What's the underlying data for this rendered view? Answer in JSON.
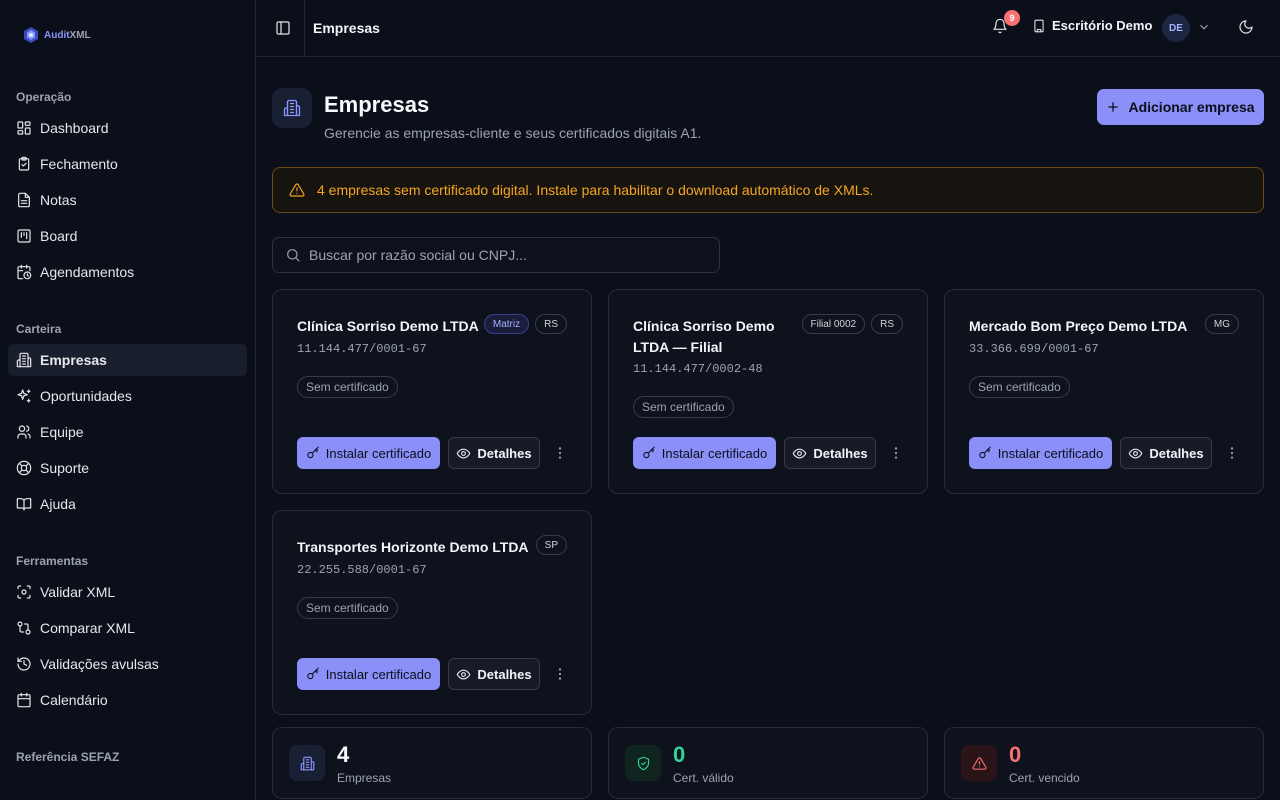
{
  "app": {
    "logo_prefix": "Audit",
    "logo_suffix": "XML"
  },
  "sidebar": {
    "sections": [
      {
        "label": "Operação"
      },
      {
        "label": "Carteira"
      },
      {
        "label": "Ferramentas"
      },
      {
        "label": "Referência SEFAZ"
      }
    ],
    "items": [
      {
        "label": "Dashboard",
        "icon": "layout-grid-icon"
      },
      {
        "label": "Fechamento",
        "icon": "clipboard-check-icon"
      },
      {
        "label": "Notas",
        "icon": "file-text-icon"
      },
      {
        "label": "Board",
        "icon": "kanban-icon"
      },
      {
        "label": "Agendamentos",
        "icon": "calendar-clock-icon"
      },
      {
        "label": "Empresas",
        "icon": "building-icon",
        "active": true
      },
      {
        "label": "Oportunidades",
        "icon": "sparkles-icon"
      },
      {
        "label": "Equipe",
        "icon": "users-icon"
      },
      {
        "label": "Suporte",
        "icon": "life-buoy-icon"
      },
      {
        "label": "Ajuda",
        "icon": "book-open-icon"
      },
      {
        "label": "Validar XML",
        "icon": "scan-icon"
      },
      {
        "label": "Comparar XML",
        "icon": "git-compare-icon"
      },
      {
        "label": "Validações avulsas",
        "icon": "history-icon"
      },
      {
        "label": "Calendário",
        "icon": "calendar-icon"
      }
    ]
  },
  "header": {
    "title": "Empresas",
    "notifications_count": "9",
    "office_name": "Escritório Demo",
    "avatar_initials": "DE"
  },
  "page": {
    "title": "Empresas",
    "subtitle": "Gerencie as empresas-cliente e seus certificados digitais A1.",
    "add_button": "Adicionar empresa"
  },
  "alert": {
    "text": "4 empresas sem certificado digital. Instale para habilitar o download automático de XMLs."
  },
  "search": {
    "placeholder": "Buscar por razão social ou CNPJ..."
  },
  "companies": [
    {
      "name": "Clínica Sorriso Demo LTDA",
      "cnpj": "11.144.477/0001-67",
      "type_badge": "Matriz",
      "uf": "RS",
      "cert": "Sem certificado"
    },
    {
      "name_line1": "Clínica Sorriso Demo",
      "name_line2": "LTDA — Filial",
      "cnpj": "11.144.477/0002-48",
      "type_badge": "Filial 0002",
      "uf": "RS",
      "cert": "Sem certificado"
    },
    {
      "name": "Mercado Bom Preço Demo LTDA",
      "cnpj": "33.366.699/0001-67",
      "uf": "MG",
      "cert": "Sem certificado"
    },
    {
      "name": "Transportes Horizonte Demo LTDA",
      "cnpj": "22.255.588/0001-67",
      "uf": "SP",
      "cert": "Sem certificado"
    }
  ],
  "card_actions": {
    "install": "Instalar certificado",
    "details": "Detalhes"
  },
  "stats": [
    {
      "value": "4",
      "label": "Empresas",
      "color": "#f9fafb",
      "icon_bg": "#1a2033",
      "icon_color": "#8b95ff"
    },
    {
      "value": "0",
      "label": "Cert. válido",
      "color": "#34d399",
      "icon_bg": "#10251f",
      "icon_color": "#34d399"
    },
    {
      "value": "0",
      "label": "Cert. vencido",
      "color": "#f87171",
      "icon_bg": "#2a1418",
      "icon_color": "#f87171"
    }
  ],
  "colors": {
    "accent": "#8b8ff8",
    "warning": "#f5a524",
    "success": "#34d399",
    "danger": "#f87171"
  }
}
